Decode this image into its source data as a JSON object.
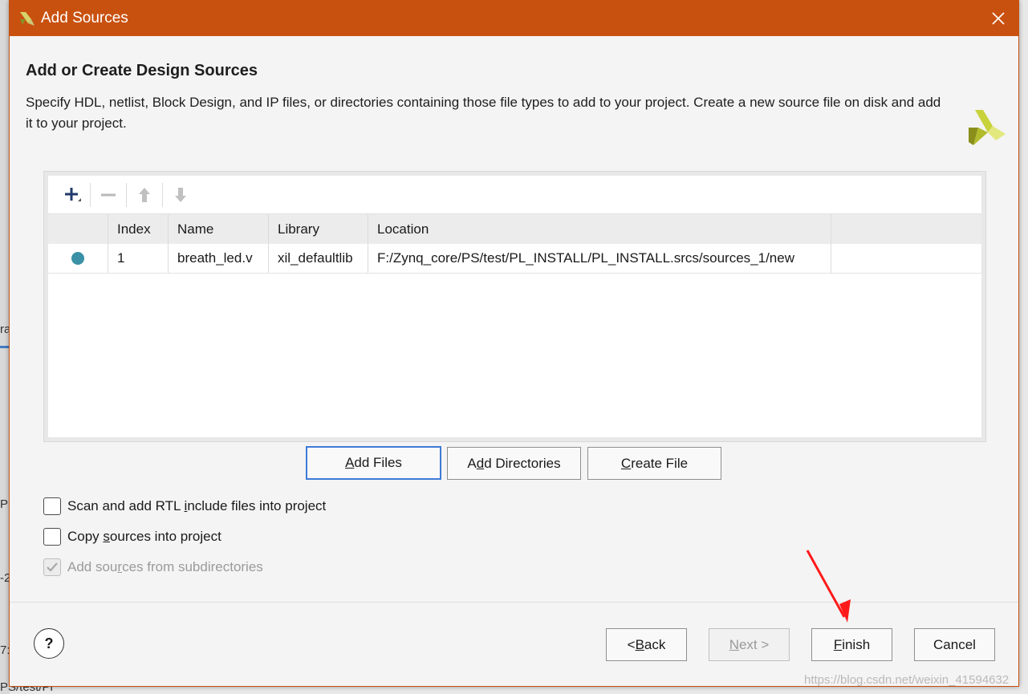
{
  "background": {
    "fragments": [
      "ra",
      "PS",
      "-2",
      "7:",
      "PS/test/Pl"
    ]
  },
  "dialog": {
    "title": "Add Sources",
    "close_icon": "close-icon",
    "brand_color": "#c9510f"
  },
  "header": {
    "title": "Add or Create Design Sources",
    "description": "Specify HDL, netlist, Block Design, and IP files, or directories containing those file types to add to your project. Create a new source file on disk and add it to your project."
  },
  "toolbar": {
    "icons": [
      "add-icon",
      "remove-icon",
      "move-up-icon",
      "move-down-icon"
    ]
  },
  "table": {
    "columns": [
      "",
      "Index",
      "Name",
      "Library",
      "Location"
    ],
    "rows": [
      {
        "status_color": "#3a91a6",
        "index": "1",
        "name": "breath_led.v",
        "library": "xil_defaultlib",
        "location": "F:/Zynq_core/PS/test/PL_INSTALL/PL_INSTALL.srcs/sources_1/new"
      }
    ]
  },
  "actions": {
    "add_files": {
      "mnemonic": "A",
      "rest": "dd Files"
    },
    "add_directories": {
      "pre": "A",
      "mnemonic": "d",
      "rest": "d Directories"
    },
    "create_file": {
      "mnemonic": "C",
      "rest": "reate File"
    }
  },
  "options": {
    "scan_rtl": {
      "pre": "Scan and add RTL ",
      "mnemonic": "i",
      "rest": "nclude files into project",
      "checked": false,
      "enabled": true
    },
    "copy_sources": {
      "pre": "Copy ",
      "mnemonic": "s",
      "rest": "ources into project",
      "checked": false,
      "enabled": true
    },
    "subdirectories": {
      "pre": "Add sou",
      "mnemonic": "r",
      "rest": "ces from subdirectories",
      "checked": true,
      "enabled": false
    }
  },
  "footer": {
    "help_label": "?",
    "back": {
      "pre": "< ",
      "mnemonic": "B",
      "rest": "ack"
    },
    "next": {
      "mnemonic": "N",
      "rest": "ext >"
    },
    "finish": {
      "mnemonic": "F",
      "rest": "inish"
    },
    "cancel": "Cancel"
  },
  "watermark": "https://blog.csdn.net/weixin_41594632",
  "annotation": {
    "arrow_color": "#ff1a1a"
  }
}
